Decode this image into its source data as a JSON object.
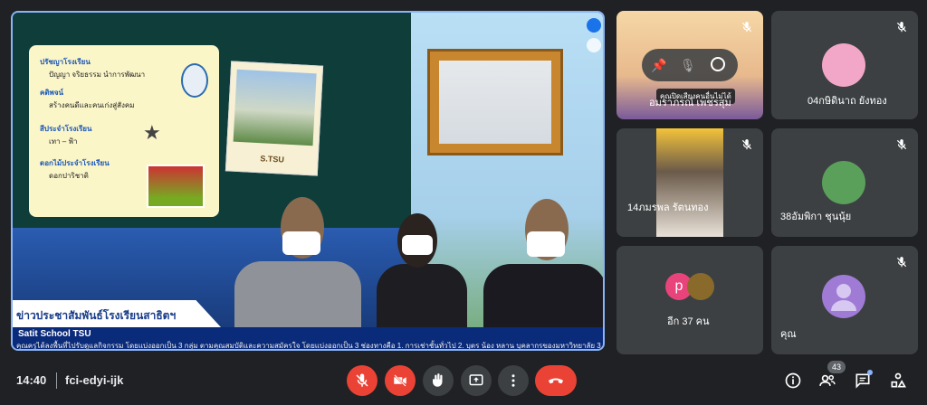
{
  "meeting": {
    "time": "14:40",
    "code": "fci-edyi-ijk"
  },
  "presentation": {
    "slide": {
      "label1": "ปรัชญาโรงเรียน",
      "text1": "ปัญญา จริยธรรม นำการพัฒนา",
      "label2": "คติพจน์",
      "text2": "สร้างคนดีและคนเก่งสู่สังคม",
      "label3": "สีประจำโรงเรียน",
      "text3": "เทา – ฟ้า",
      "label4": "ดอกไม้ประจำโรงเรียน",
      "text4": "ดอกปาริชาติ",
      "photo_caption": "S.TSU"
    },
    "news_title": "ข่าวประชาสัมพันธ์โรงเรียนสาธิตฯ",
    "ticker_brand": "Satit School TSU",
    "ticker_text": "คุณครูได้ลงพื้นที่ไปรับดูแลกิจกรรม โดยแบ่งออกเป็น 3 กลุ่ม ตามคุณสมบัติและความสมัครใจ โดยแบ่งออกเป็น 3 ช่องทางคือ 1. การเช่าชั้นทั่วไป 2. บุตร น้อง หลาน บุคลากรของมหาวิทยาลัย 3"
  },
  "participants": [
    {
      "name": "อมราภรณ์ เพชรสุม",
      "tooltip": "คุณปิดเสียงคนอื่นไม่ได้"
    },
    {
      "name": "04กษิดินาถ ยังทอง"
    },
    {
      "name": "14ภมรพล รัตนทอง"
    },
    {
      "name": "38อัมพิกา ชุนนุ้ย"
    },
    {
      "name": "อีก 37 คน",
      "avatar_letter": "p"
    },
    {
      "name": "คุณ"
    }
  ],
  "people_count": "43",
  "colors": {
    "accent": "#8ab4f8",
    "danger": "#ea4335",
    "tile": "#3c4043"
  }
}
